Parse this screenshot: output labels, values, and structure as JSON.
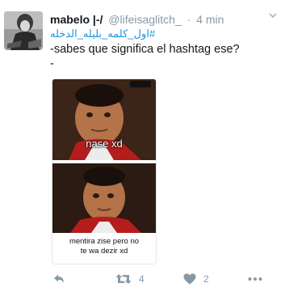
{
  "tweet": {
    "name": "mabelo |-/",
    "handle": "@lifeisaglitch_",
    "separator": "·",
    "time": "4 min",
    "hashtag": "#اول_كلمه_بليله_الدخله",
    "line1": "-sabes que significa el hashtag ese?",
    "line2": "-"
  },
  "media": {
    "caption_top": "nase xd",
    "caption_bottom_line1": "mentira zise pero no",
    "caption_bottom_line2": "te wa dezir xd"
  },
  "actions": {
    "retweet_count": "4",
    "like_count": "2"
  },
  "colors": {
    "link": "#1b95e0",
    "muted": "#8899a6",
    "text": "#14171a"
  }
}
